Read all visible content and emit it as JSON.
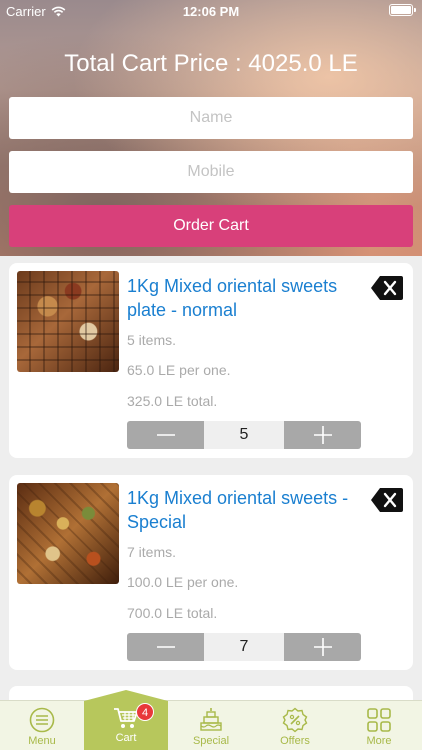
{
  "status_bar": {
    "carrier": "Carrier",
    "time": "12:06 PM"
  },
  "header": {
    "total_text": "Total Cart Price : 4025.0 LE"
  },
  "form": {
    "name_placeholder": "Name",
    "mobile_placeholder": "Mobile",
    "order_label": "Order Cart"
  },
  "cart_items": [
    {
      "title": "1Kg Mixed oriental sweets plate - normal",
      "items": "5 items.",
      "price_each": "65.0 LE per one.",
      "total": "325.0 LE total.",
      "quantity": "5"
    },
    {
      "title": "1Kg Mixed oriental sweets - Special",
      "items": "7 items.",
      "price_each": "100.0 LE per one.",
      "total": "700.0 LE total.",
      "quantity": "7"
    }
  ],
  "tabbar": {
    "menu": "Menu",
    "cart": "Cart",
    "cart_badge": "4",
    "special": "Special",
    "offers": "Offers",
    "more": "More"
  },
  "colors": {
    "accent_pink": "#d8407a",
    "title_blue": "#1a7fd0",
    "tab_green": "#b7c75c",
    "badge_red": "#e8393a"
  }
}
